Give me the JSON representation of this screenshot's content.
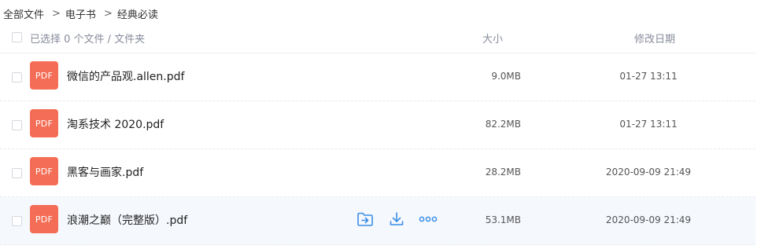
{
  "breadcrumb": {
    "items": [
      "全部文件",
      "电子书",
      "经典必读"
    ],
    "separator": ">"
  },
  "header": {
    "selection_text": "已选择 0 个文件 / 文件夹",
    "col_size": "大小",
    "col_date": "修改日期"
  },
  "file_icon_label": "PDF",
  "files": [
    {
      "name": "微信的产品观.allen.pdf",
      "size": "9.0MB",
      "date": "01-27 13:11"
    },
    {
      "name": "淘系技术 2020.pdf",
      "size": "82.2MB",
      "date": "01-27 13:11"
    },
    {
      "name": "黑客与画家.pdf",
      "size": "28.2MB",
      "date": "2020-09-09 21:49"
    },
    {
      "name": "浪潮之巅（完整版）.pdf",
      "size": "53.1MB",
      "date": "2020-09-09 21:49"
    }
  ],
  "hover_actions": [
    "move-icon",
    "download-icon",
    "more-icon"
  ],
  "colors": {
    "pdf_badge": "#f46d56",
    "action_blue": "#3a8ee6",
    "hover_row_bg": "#f5f8fd"
  }
}
